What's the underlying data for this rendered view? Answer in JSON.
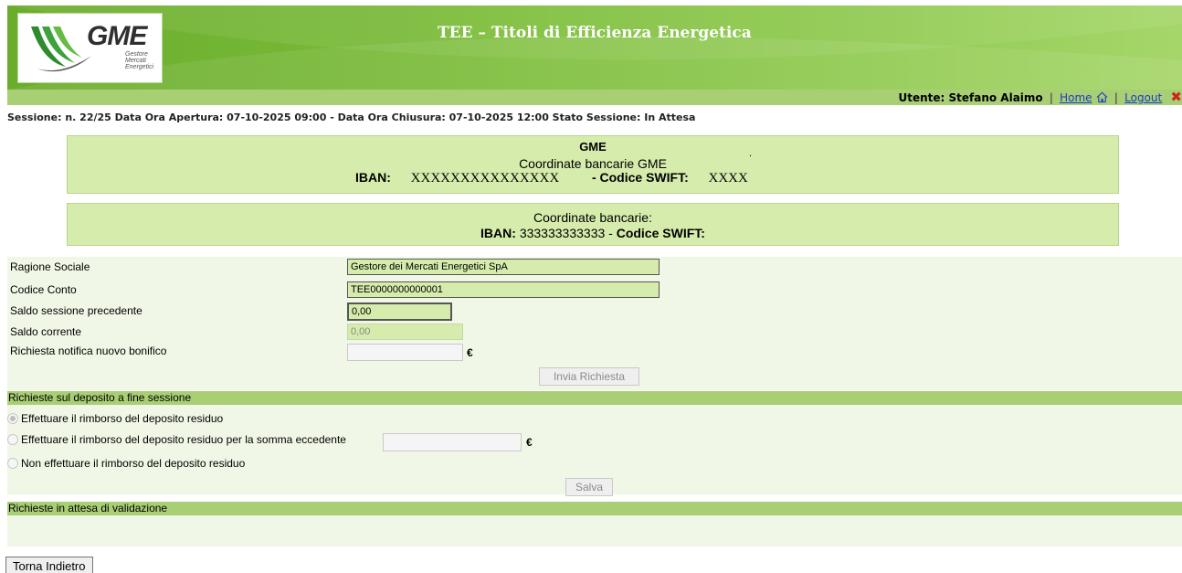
{
  "header": {
    "logo_text": "GME",
    "logo_sub_1": "Gestore",
    "logo_sub_2": "Mercati",
    "logo_sub_3": "Energetici",
    "title": "TEE – Titoli di Efficienza Energetica"
  },
  "userbar": {
    "user_label": "Utente: Stefano Alaimo",
    "home_label": "Home",
    "logout_label": "Logout",
    "sep": "|"
  },
  "session": {
    "text": "Sessione: n. 22/25 Data Ora Apertura: 07-10-2025 09:00   - Data Ora Chiusura: 07-10-2025 12:00 Stato Sessione: In Attesa"
  },
  "bank_gme": {
    "title": "GME",
    "coord_label": "Coordinate bancarie GME",
    "dot": ".",
    "iban_label": "IBAN:",
    "iban_value": "XXXXXXXXXXXXXXX",
    "swift_label": "- Codice SWIFT:",
    "swift_value": "XXXX"
  },
  "bank_user": {
    "coord_label": "Coordinate bancarie:",
    "iban_label": "IBAN:",
    "iban_value": " 333333333333 - ",
    "swift_label": "Codice SWIFT:"
  },
  "form": {
    "ragione_sociale_label": "Ragione Sociale",
    "ragione_sociale_value": "Gestore dei Mercati Energetici SpA",
    "codice_conto_label": "Codice Conto",
    "codice_conto_value": "TEE0000000000001",
    "saldo_prec_label": "Saldo sessione precedente",
    "saldo_prec_value": "0,00",
    "saldo_corr_label": "Saldo corrente",
    "saldo_corr_value": "0,00",
    "richiesta_label": "Richiesta notifica nuovo bonifico",
    "richiesta_value": "",
    "euro": "€",
    "invia_label": "Invia Richiesta"
  },
  "deposito": {
    "section_title": "Richieste sul deposito a fine sessione",
    "option_1": "Effettuare il rimborso del deposito residuo",
    "option_2": "Effettuare il rimborso del deposito residuo per la somma eccedente",
    "option_2_value": "",
    "option_3": "Non effettuare il rimborso del deposito residuo",
    "euro": "€",
    "salva_label": "Salva"
  },
  "validazione": {
    "section_title": "Richieste in attesa di validazione"
  },
  "footer": {
    "back_label": "Torna Indietro"
  },
  "colors": {
    "header_green": "#7cbd3a",
    "bar_green": "#a8cf74",
    "box_green": "#d6ecac",
    "logout_red": "#d0261c",
    "link_blue": "#1a3ccc"
  }
}
